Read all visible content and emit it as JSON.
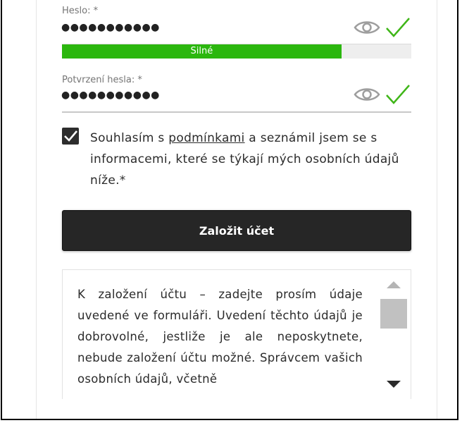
{
  "password": {
    "label": "Heslo: *",
    "value": "●●●●●●●●●●●",
    "strength_label": "Silné",
    "strength_fraction": 0.8
  },
  "confirm": {
    "label": "Potvrzení hesla: *",
    "value": "●●●●●●●●●●●"
  },
  "consent": {
    "checked": true,
    "text_before": "Souhlasím s ",
    "link_text": "podmínkami",
    "text_after": " a seznámil jsem se s informacemi, které se týkají mých osobních údajů níže.*"
  },
  "submit_label": "Založit účet",
  "info_text": "K založení účtu – zadejte prosím údaje uvedené ve formuláři. Uvedení těchto údajů je dobrovolné, jestliže je ale neposkytnete, nebude založení účtu možné. Správcem vašich osobních údajů, včetně",
  "colors": {
    "strength_bar": "#2bb70e",
    "check_icon": "#3fb618",
    "eye_icon": "#9e9e9e",
    "button_bg": "#262626"
  }
}
